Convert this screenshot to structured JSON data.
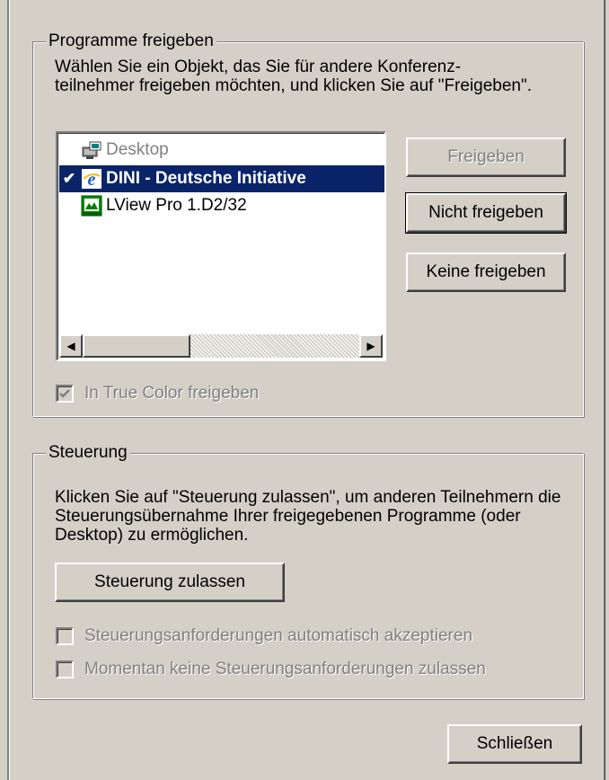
{
  "share": {
    "group_label": "Programme freigeben",
    "description": "Wählen Sie ein Objekt, das Sie für andere Konferenz-teilnehmer freigeben möchten, und klicken Sie auf \"Freigeben\".",
    "items": [
      {
        "label": "Desktop",
        "icon": "desktop-icon",
        "state": "disabled",
        "checked": false
      },
      {
        "label": "DINI - Deutsche Initiative",
        "icon": "internet-explorer-icon",
        "state": "selected",
        "checked": true
      },
      {
        "label": "LView Pro 1.D2/32",
        "icon": "lview-pro-icon",
        "state": "normal",
        "checked": false
      }
    ],
    "share_button": "Freigeben",
    "unshare_button": "Nicht freigeben",
    "unshare_all_button": "Keine freigeben",
    "true_color_checkbox": {
      "label": "In True Color freigeben",
      "checked": true,
      "enabled": false
    }
  },
  "control": {
    "group_label": "Steuerung",
    "description": "Klicken Sie auf \"Steuerung zulassen\", um anderen Teilnehmern die Steuerungsübernahme Ihrer freigegebenen Programme (oder Desktop) zu ermöglichen.",
    "allow_button": "Steuerung zulassen",
    "auto_accept": {
      "label": "Steuerungsanforderungen automatisch akzeptieren",
      "checked": false,
      "enabled": false
    },
    "no_requests": {
      "label": "Momentan keine Steuerungsanforderungen zulassen",
      "checked": false,
      "enabled": false
    }
  },
  "close_button": "Schließen",
  "colors": {
    "selection": "#0a246a",
    "face": "#d4d0c8",
    "disabled_text": "#808080"
  }
}
